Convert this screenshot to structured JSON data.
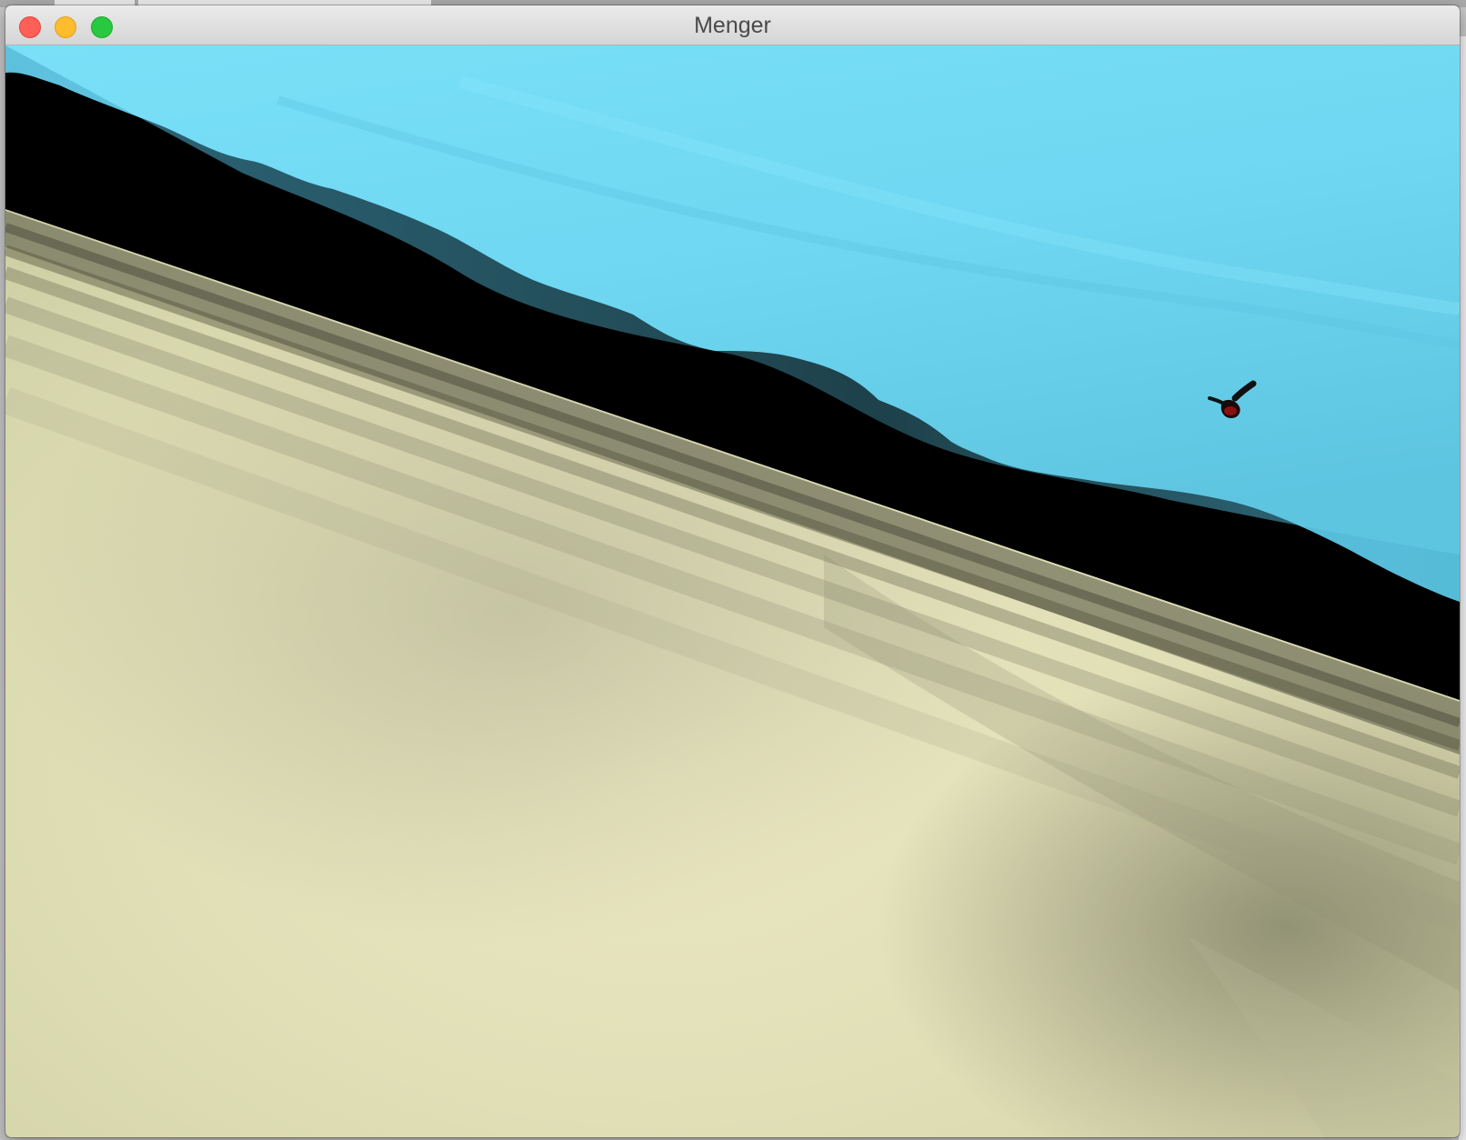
{
  "window": {
    "title": "Menger"
  },
  "titlebar": {
    "buttons": [
      {
        "name": "close",
        "color": "#fe5f57"
      },
      {
        "name": "minimize",
        "color": "#febc2e"
      },
      {
        "name": "zoom",
        "color": "#28c840"
      }
    ]
  },
  "scene": {
    "sky_colors": [
      "#79e1fb",
      "#5fc5e0",
      "#48a9c4"
    ],
    "void_color": "#000000",
    "terrain_colors": [
      "#ece9c1",
      "#d7d7ad",
      "#8f8f74",
      "#5c5c48"
    ],
    "bird_color": "#7a0a0a"
  }
}
